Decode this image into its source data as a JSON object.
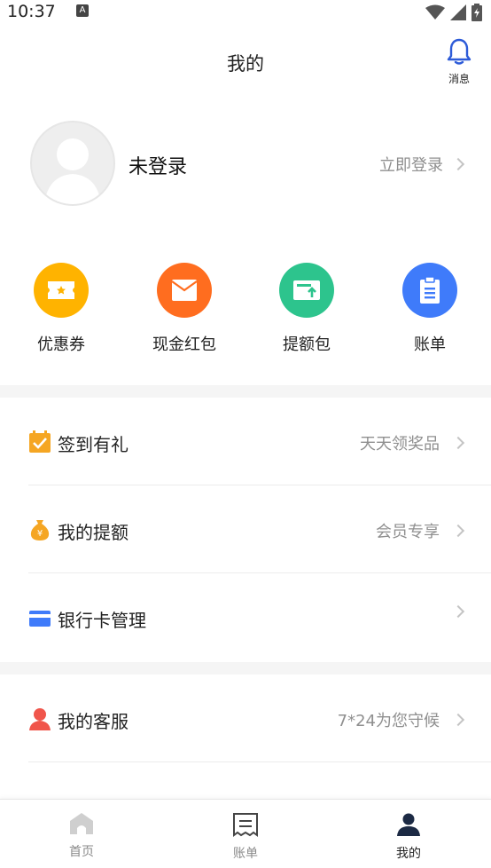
{
  "status_bar": {
    "time": "10:37",
    "badge": "A"
  },
  "header": {
    "title": "我的",
    "message_label": "消息"
  },
  "profile": {
    "name": "未登录",
    "login_link": "立即登录"
  },
  "quick_actions": [
    {
      "label": "优惠券",
      "icon": "coupon-icon",
      "color": "#FFB300"
    },
    {
      "label": "现金红包",
      "icon": "red-envelope-icon",
      "color": "#FF6D1F"
    },
    {
      "label": "提额包",
      "icon": "quota-package-icon",
      "color": "#2DC48D"
    },
    {
      "label": "账单",
      "icon": "bill-icon",
      "color": "#3F7BFA"
    }
  ],
  "menu": [
    {
      "label": "签到有礼",
      "right": "天天领奖品",
      "icon": "calendar-check-icon",
      "color": "#F5A623"
    },
    {
      "label": "我的提额",
      "right": "会员专享",
      "icon": "money-bag-icon",
      "color": "#F5A623"
    },
    {
      "label": "银行卡管理",
      "right": "",
      "icon": "bank-card-icon",
      "color": "#3F7BFA"
    },
    {
      "label": "我的客服",
      "right": "7*24为您守候",
      "icon": "customer-service-icon",
      "color": "#F0554B"
    }
  ],
  "tabs": [
    {
      "label": "首页",
      "icon": "home-icon",
      "active": false
    },
    {
      "label": "账单",
      "icon": "bill-tab-icon",
      "active": false
    },
    {
      "label": "我的",
      "icon": "profile-icon",
      "active": true
    }
  ]
}
